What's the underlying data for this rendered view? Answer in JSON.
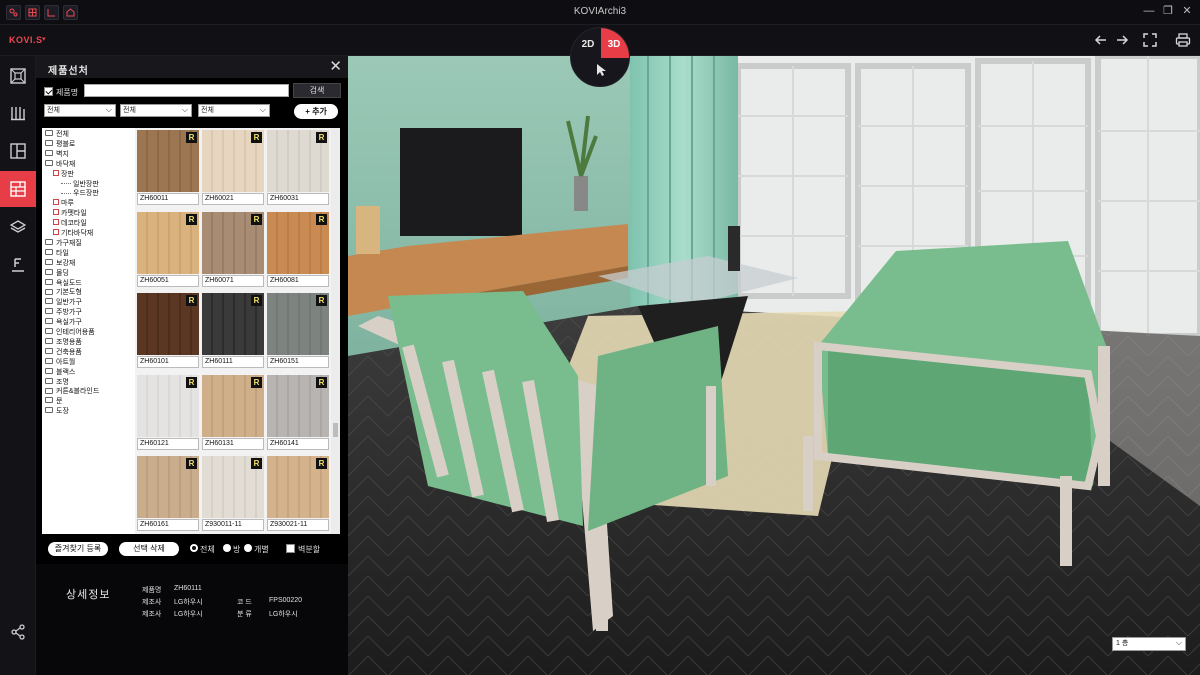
{
  "titlebar": {
    "app_title": "KOVIArchi3",
    "left_icons": [
      "settings-icon",
      "grid-icon",
      "ruler-icon",
      "home-icon"
    ],
    "window_controls": {
      "minimize": "—",
      "restore": "❐",
      "close": "✕"
    }
  },
  "toolbar": {
    "brand": "KOVI.S",
    "brand_caret": "▾",
    "view_toggle": {
      "label_2d": "2D",
      "label_3d": "3D",
      "active": "3D"
    },
    "right_icons": [
      "undo-icon",
      "redo-icon",
      "fullscreen-icon",
      "print-icon"
    ]
  },
  "sidebar": {
    "items": [
      "floorplan-icon",
      "library-icon",
      "layout-icon",
      "floor-material-icon",
      "layers-icon",
      "text-icon",
      "share-icon"
    ],
    "active_index": 3
  },
  "panel": {
    "title": "제품선처",
    "close": "✕",
    "product_name_label": "제품명",
    "product_name_checked": true,
    "search_value": "",
    "search_button": "검색",
    "filters": [
      "전체",
      "전체",
      "전체"
    ],
    "add_button": "+ 추가",
    "tree": [
      {
        "label": "전체",
        "level": 0,
        "type": "folder"
      },
      {
        "label": "평블로",
        "level": 0,
        "type": "folder"
      },
      {
        "label": "벽지",
        "level": 0,
        "type": "folder"
      },
      {
        "label": "바닥재",
        "level": 0,
        "type": "folder"
      },
      {
        "label": "장판",
        "level": 1,
        "type": "plus"
      },
      {
        "label": "일반장판",
        "level": 2,
        "type": "leaf"
      },
      {
        "label": "우드장판",
        "level": 2,
        "type": "leaf"
      },
      {
        "label": "마루",
        "level": 1,
        "type": "plus"
      },
      {
        "label": "카펫타일",
        "level": 1,
        "type": "plus"
      },
      {
        "label": "데코타일",
        "level": 1,
        "type": "plus"
      },
      {
        "label": "기타바닥재",
        "level": 1,
        "type": "plus"
      },
      {
        "label": "가구재질",
        "level": 0,
        "type": "folder"
      },
      {
        "label": "타일",
        "level": 0,
        "type": "folder"
      },
      {
        "label": "보강재",
        "level": 0,
        "type": "folder"
      },
      {
        "label": "몰딩",
        "level": 0,
        "type": "folder"
      },
      {
        "label": "욕실도드",
        "level": 0,
        "type": "folder"
      },
      {
        "label": "기본도형",
        "level": 0,
        "type": "folder"
      },
      {
        "label": "일반가구",
        "level": 0,
        "type": "folder"
      },
      {
        "label": "주방가구",
        "level": 0,
        "type": "folder"
      },
      {
        "label": "욕실가구",
        "level": 0,
        "type": "folder"
      },
      {
        "label": "인테리어용품",
        "level": 0,
        "type": "folder"
      },
      {
        "label": "조명용품",
        "level": 0,
        "type": "folder"
      },
      {
        "label": "건축용품",
        "level": 0,
        "type": "folder"
      },
      {
        "label": "아트월",
        "level": 0,
        "type": "folder"
      },
      {
        "label": "블랙스",
        "level": 0,
        "type": "folder"
      },
      {
        "label": "조명",
        "level": 0,
        "type": "folder"
      },
      {
        "label": "커튼&블라인드",
        "level": 0,
        "type": "folder"
      },
      {
        "label": "문",
        "level": 0,
        "type": "folder"
      },
      {
        "label": "도장",
        "level": 0,
        "type": "folder"
      }
    ],
    "products": [
      {
        "name": "ZH60011",
        "badge": "R",
        "color": "#9c7650",
        "grain": "#7d5a3a"
      },
      {
        "name": "ZH60021",
        "badge": "R",
        "color": "#e6d6bf",
        "grain": "#cdbba1"
      },
      {
        "name": "ZH60031",
        "badge": "R",
        "color": "#dedad2",
        "grain": "#c8c3b8"
      },
      {
        "name": "ZH60051",
        "badge": "R",
        "color": "#d9b27e",
        "grain": "#c19862"
      },
      {
        "name": "ZH60071",
        "badge": "R",
        "color": "#a88c74",
        "grain": "#8a705a"
      },
      {
        "name": "ZH60081",
        "badge": "R",
        "color": "#c98b52",
        "grain": "#ad703c"
      },
      {
        "name": "ZH60101",
        "badge": "R",
        "color": "#5a3623",
        "grain": "#3f2416"
      },
      {
        "name": "ZH60111",
        "badge": "R",
        "color": "#3a3a3a",
        "grain": "#1f1f1f"
      },
      {
        "name": "ZH60151",
        "badge": "R",
        "color": "#7d8480",
        "grain": "#666d69"
      },
      {
        "name": "ZH60121",
        "badge": "R",
        "color": "#e4e3e2",
        "grain": "#cfcdcb"
      },
      {
        "name": "ZH60131",
        "badge": "R",
        "color": "#cfae8a",
        "grain": "#b59470"
      },
      {
        "name": "ZH60141",
        "badge": "R",
        "color": "#b8b4b2",
        "grain": "#9e9a98"
      },
      {
        "name": "ZH60161",
        "badge": "R",
        "color": "#c9ad8d",
        "grain": "#b19475"
      },
      {
        "name": "Z930011-11",
        "badge": "R",
        "color": "#e2ddd4",
        "grain": "#cbc4b8"
      },
      {
        "name": "Z930021-11",
        "badge": "R",
        "color": "#d4b38c",
        "grain": "#bb9772"
      }
    ],
    "favorite_button": "즐겨찾기 등록",
    "delete_button": "선택 삭제",
    "scope_options": [
      "전체",
      "방",
      "개별"
    ],
    "scope_selected": "전체",
    "wall_option": "벽분할"
  },
  "detail": {
    "title": "상세정보",
    "rows": [
      {
        "key": "제품명",
        "value": "ZH60111"
      },
      {
        "key": "제조사",
        "value": "LG하우시"
      },
      {
        "key": "제조사",
        "value": "LG하우시"
      }
    ],
    "right_rows": [
      {
        "key": "코 드",
        "value": "FPS00220"
      },
      {
        "key": "분 류",
        "value": "LG하우시"
      }
    ]
  },
  "viewport": {
    "floor_select": "1 층",
    "colors": {
      "wall": "#8dc2ad",
      "sofa": "#79bd8e",
      "frame": "#d8d0c6",
      "floor": "#2c2c2c",
      "window_light": "#f1f4f2"
    }
  }
}
